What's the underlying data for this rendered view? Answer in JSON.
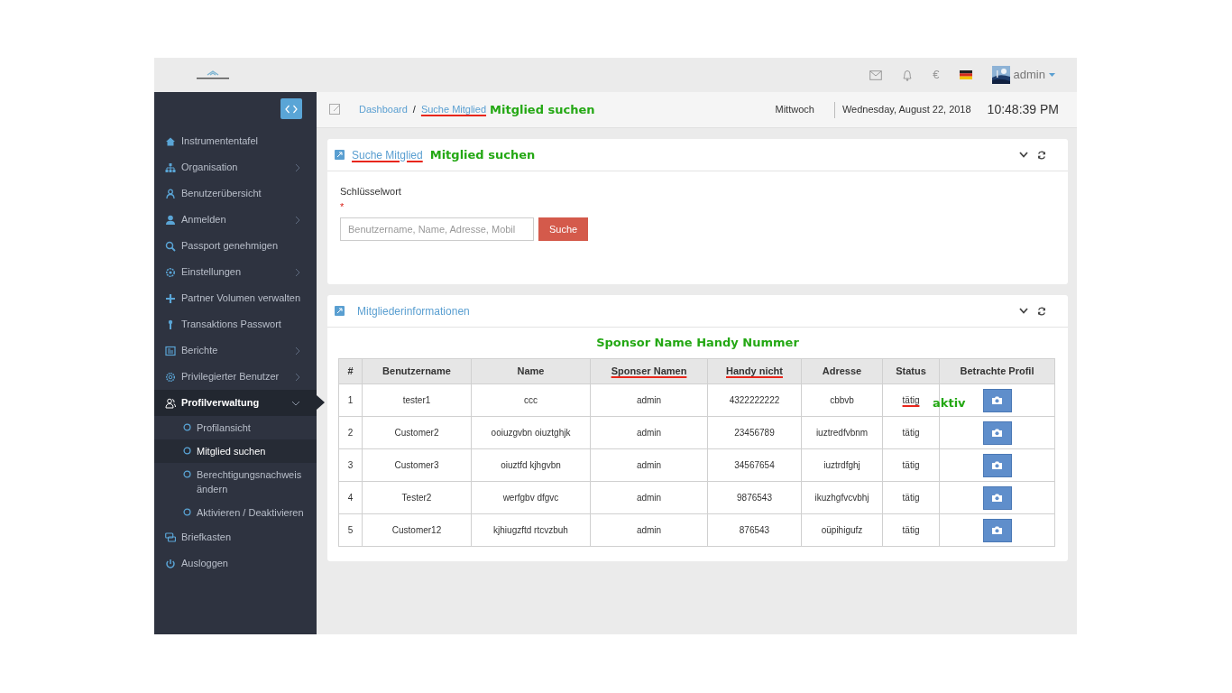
{
  "header": {
    "currency": "€",
    "user": "admin"
  },
  "sidebar": {
    "items": [
      {
        "label": "Instrumententafel",
        "selected": false
      },
      {
        "label": "Organisation",
        "selected": false,
        "expanded": false
      },
      {
        "label": "Benutzerübersicht",
        "selected": false
      },
      {
        "label": "Anmelden",
        "selected": false,
        "expanded": false
      },
      {
        "label": "Passport genehmigen",
        "selected": false
      },
      {
        "label": "Einstellungen",
        "selected": false,
        "expanded": false
      },
      {
        "label": "Partner Volumen verwalten",
        "selected": false
      },
      {
        "label": "Transaktions Passwort",
        "selected": false
      },
      {
        "label": "Berichte",
        "selected": false,
        "expanded": false
      },
      {
        "label": "Privilegierter Benutzer",
        "selected": false,
        "expanded": false
      },
      {
        "label": "Profilverwaltung",
        "selected": true,
        "expanded": true,
        "children": [
          {
            "label": "Profilansicht",
            "selected": false
          },
          {
            "label": "Mitglied suchen",
            "selected": true
          },
          {
            "label": "Berechtigungsnachweis ändern",
            "selected": false
          },
          {
            "label": "Aktivieren / Deaktivieren",
            "selected": false
          }
        ]
      },
      {
        "label": "Briefkasten",
        "selected": false
      },
      {
        "label": "Ausloggen",
        "selected": false
      }
    ]
  },
  "breadcrumb": {
    "separator": "/",
    "items": [
      {
        "label": "Dashboard",
        "struck": false
      },
      {
        "label": "Suche Mitglied",
        "struck": true
      }
    ],
    "annotation": "Mitglied suchen"
  },
  "datebar": {
    "day": "Mittwoch",
    "date": "Wednesday, August 22, 2018",
    "time": "10:48:39 PM"
  },
  "search_panel": {
    "title": "Suche Mitglied",
    "title_struck": true,
    "annotation": "Mitglied suchen",
    "field_label": "Schlüsselwort",
    "required_mark": "*",
    "placeholder": "Benutzername, Name, Adresse, Mobil",
    "button": "Suche"
  },
  "members_panel": {
    "title": "Mitgliederinformationen",
    "annotation": "Sponsor Name Handy Nummer",
    "columns": [
      {
        "label": "#",
        "struck": false
      },
      {
        "label": "Benutzername",
        "struck": false
      },
      {
        "label": "Name",
        "struck": false
      },
      {
        "label": "Sponser Namen",
        "struck": true
      },
      {
        "label": "Handy nicht",
        "struck": true
      },
      {
        "label": "Adresse",
        "struck": false
      },
      {
        "label": "Status",
        "struck": false
      },
      {
        "label": "Betrachte Profil",
        "struck": false
      }
    ],
    "rows": [
      {
        "cells": [
          "1",
          "tester1",
          "ccc",
          "admin",
          "4322222222",
          "cbbvb"
        ],
        "status": "tätig",
        "status_struck": true,
        "status_annotation": "aktiv"
      },
      {
        "cells": [
          "2",
          "Customer2",
          "ooiuzgvbn oiuztghjk",
          "admin",
          "23456789",
          "iuztredfvbnm"
        ],
        "status": "tätig",
        "status_struck": false
      },
      {
        "cells": [
          "3",
          "Customer3",
          "oiuztfd kjhgvbn",
          "admin",
          "34567654",
          "iuztrdfghj"
        ],
        "status": "tätig",
        "status_struck": false
      },
      {
        "cells": [
          "4",
          "Tester2",
          "werfgbv dfgvc",
          "admin",
          "9876543",
          "ikuzhgfvcvbhj"
        ],
        "status": "tätig",
        "status_struck": false
      },
      {
        "cells": [
          "5",
          "Customer12",
          "kjhiugzftd rtcvzbuh",
          "admin",
          "876543",
          "oüpihigufz"
        ],
        "status": "tätig",
        "status_struck": false
      }
    ]
  }
}
